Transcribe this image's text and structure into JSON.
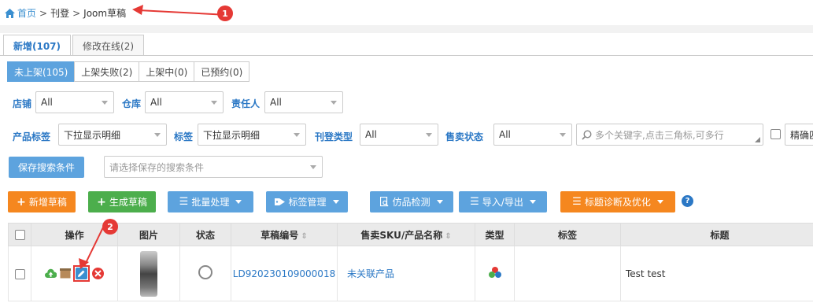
{
  "breadcrumb": {
    "home": "首页",
    "sep1": ">",
    "item1": "刊登",
    "sep2": ">",
    "item2": "Joom草稿"
  },
  "annotations": [
    "1",
    "2"
  ],
  "tabs": [
    {
      "label": "新增(107)"
    },
    {
      "label": "修改在线(2)"
    }
  ],
  "subtabs": [
    {
      "label": "未上架(105)"
    },
    {
      "label": "上架失败(2)"
    },
    {
      "label": "上架中(0)"
    },
    {
      "label": "已预约(0)"
    }
  ],
  "filters": {
    "shop_label": "店铺",
    "shop_value": "All",
    "warehouse_label": "仓库",
    "warehouse_value": "All",
    "owner_label": "责任人",
    "owner_value": "All",
    "product_tag_label": "产品标签",
    "product_tag_value": "下拉显示明细",
    "tag_label": "标签",
    "tag_value": "下拉显示明细",
    "listing_type_label": "刊登类型",
    "listing_type_value": "All",
    "sale_status_label": "售卖状态",
    "sale_status_value": "All",
    "keyword_placeholder": "多个关键字,点击三角标,可多行",
    "exact_label": "精确匹"
  },
  "saved_search": {
    "button": "保存搜索条件",
    "placeholder": "请选择保存的搜索条件"
  },
  "toolbar": {
    "new_draft": "新增草稿",
    "gen_draft": "生成草稿",
    "batch": "批量处理",
    "tag_mgmt": "标签管理",
    "imitation": "仿品检测",
    "import_export": "导入/导出",
    "title_diag": "标题诊断及优化",
    "help": "?"
  },
  "table": {
    "headers": {
      "ops": "操作",
      "image": "图片",
      "status": "状态",
      "draft_no": "草稿编号",
      "sku": "售卖SKU/产品名称",
      "type": "类型",
      "tag": "标签",
      "title": "标题"
    },
    "rows": [
      {
        "draft_no": "LD920230109000018",
        "sku": "未关联产品",
        "title": "Test test"
      }
    ]
  },
  "colors": {
    "accent": "#2b78c5",
    "active_tab": "#5da3de",
    "orange": "#f5871f",
    "green": "#4cae4c",
    "annotation": "#e53935"
  }
}
